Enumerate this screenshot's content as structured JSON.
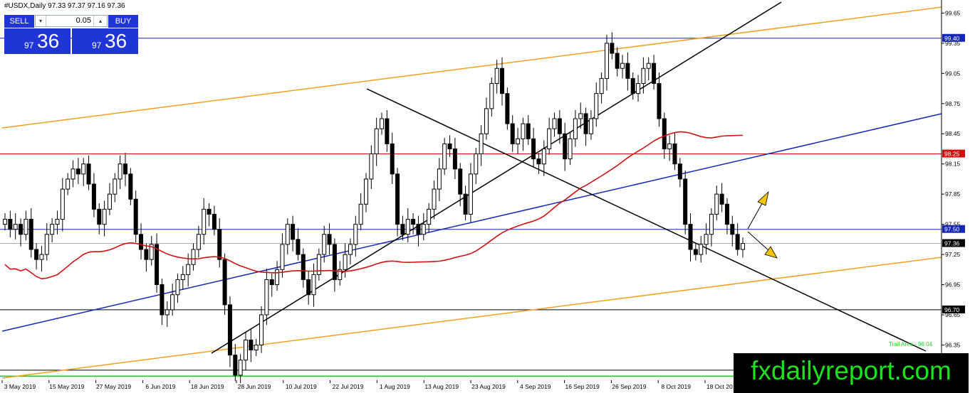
{
  "window": {
    "title": "#USDX,Daily  97.33 97.37 97.16 97.36"
  },
  "trade_panel": {
    "sell_label": "SELL",
    "buy_label": "BUY",
    "lot_value": "0.05",
    "sell_price_prefix": "97",
    "sell_price_main": "36",
    "buy_price_prefix": "97",
    "buy_price_main": "36"
  },
  "watermark": "fxdailyreport.com",
  "colors": {
    "bull_body": "#ffffff",
    "bear_body": "#000000",
    "ma": "#d01010",
    "blue_line": "#1428b4",
    "orange_line": "#f0a020",
    "green_line": "#22cc22",
    "red_level": "#d01010"
  },
  "chart_data": {
    "type": "candlestick",
    "symbol": "#USDX",
    "timeframe": "Daily",
    "ohlc_readout": {
      "open": 97.33,
      "high": 97.37,
      "low": 97.16,
      "close": 97.36
    },
    "ylim": [
      96.0,
      99.78
    ],
    "y_ticks": [
      "99.65",
      "99.40",
      "99.35",
      "99.05",
      "98.75",
      "98.45",
      "98.15",
      "97.85",
      "97.55",
      "97.25",
      "96.95",
      "96.65",
      "96.35",
      "96.05"
    ],
    "x_ticks": [
      "3 May 2019",
      "15 May 2019",
      "27 May 2019",
      "6 Jun 2019",
      "18 Jun 2019",
      "28 Jun 2019",
      "10 Jul 2019",
      "22 Jul 2019",
      "1 Aug 2019",
      "13 Aug 2019",
      "23 Aug 2019",
      "4 Sep 2019",
      "16 Sep 2019",
      "26 Sep 2019",
      "8 Oct 2019",
      "18 Oct 2019"
    ],
    "price_labels": [
      {
        "value": 99.4,
        "text": "99.40",
        "color": "#1428b4"
      },
      {
        "value": 98.25,
        "text": "98.25",
        "color": "#d01010"
      },
      {
        "value": 97.5,
        "text": "97.50",
        "color": "#1428b4"
      },
      {
        "value": 97.36,
        "text": "97.36",
        "color": "#000000"
      },
      {
        "value": 96.7,
        "text": "96.70",
        "color": "#000000"
      },
      {
        "value": 96.1,
        "text": "96.10",
        "color": "#000000"
      }
    ],
    "horizontal_levels": [
      {
        "value": 99.4,
        "color": "#1428b4"
      },
      {
        "value": 98.25,
        "color": "#d01010"
      },
      {
        "value": 97.5,
        "color": "#1428b4"
      },
      {
        "value": 97.36,
        "color": "#b0b0b0"
      },
      {
        "value": 96.7,
        "color": "#000000"
      },
      {
        "value": 96.1,
        "color": "#000000"
      },
      {
        "value": 96.04,
        "color": "#22cc22"
      }
    ],
    "green_label": "Trail Area - 96.04",
    "closes": [
      97.6,
      97.5,
      97.55,
      97.45,
      97.6,
      97.3,
      97.2,
      97.25,
      97.45,
      97.55,
      97.6,
      97.9,
      98.0,
      98.1,
      98.05,
      98.15,
      97.95,
      97.7,
      97.55,
      97.7,
      97.85,
      98.0,
      98.15,
      98.05,
      97.8,
      97.45,
      97.3,
      97.2,
      97.35,
      96.95,
      96.65,
      96.7,
      96.85,
      97.0,
      97.05,
      97.15,
      97.3,
      97.45,
      97.7,
      97.65,
      97.5,
      97.2,
      96.75,
      96.25,
      96.05,
      96.2,
      96.4,
      96.3,
      96.35,
      96.65,
      97.0,
      96.95,
      97.1,
      97.35,
      97.55,
      97.4,
      97.25,
      97.0,
      96.85,
      97.05,
      97.25,
      97.45,
      97.35,
      97.0,
      97.1,
      97.25,
      97.35,
      97.55,
      97.75,
      98.0,
      98.25,
      98.5,
      98.6,
      98.35,
      98.05,
      97.55,
      97.45,
      97.6,
      97.55,
      97.45,
      97.55,
      97.7,
      97.9,
      98.1,
      98.35,
      98.3,
      98.1,
      97.85,
      97.65,
      98.05,
      98.25,
      98.45,
      98.7,
      98.95,
      99.1,
      98.85,
      98.55,
      98.35,
      98.4,
      98.55,
      98.4,
      98.2,
      98.15,
      98.3,
      98.5,
      98.6,
      98.45,
      98.2,
      98.4,
      98.6,
      98.65,
      98.45,
      98.6,
      98.85,
      99.0,
      99.35,
      99.25,
      99.1,
      99.15,
      99.0,
      98.85,
      98.95,
      99.1,
      99.15,
      98.95,
      98.6,
      98.3,
      98.35,
      98.15,
      98.0,
      97.55,
      97.3,
      97.25,
      97.35,
      97.45,
      97.65,
      97.85,
      97.75,
      97.55,
      97.45,
      97.3,
      97.36
    ]
  }
}
